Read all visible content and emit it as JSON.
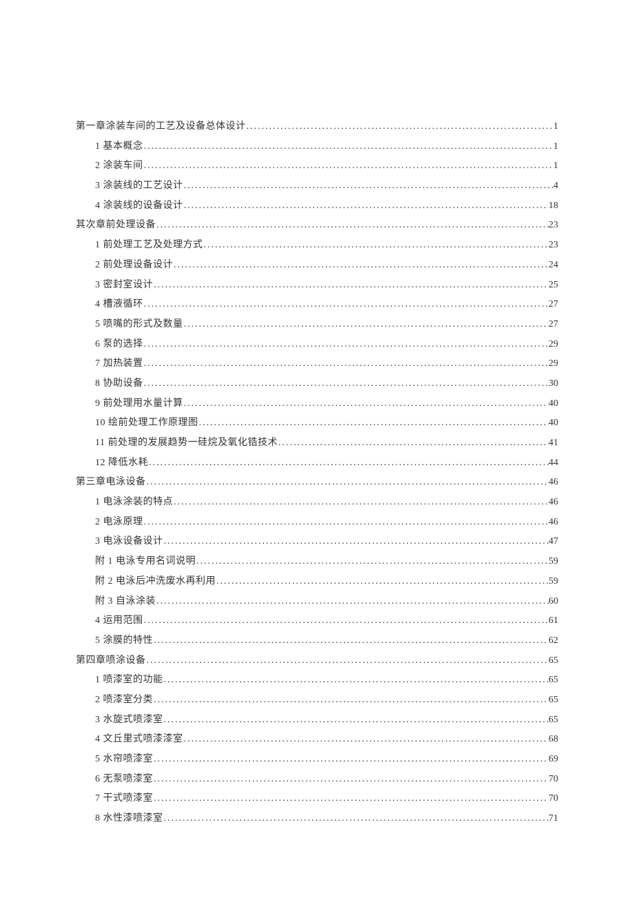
{
  "toc": [
    {
      "level": 1,
      "title": "第一章涂装车间的工艺及设备总体设计",
      "page": "1"
    },
    {
      "level": 2,
      "title": "1 基本概念",
      "page": "1"
    },
    {
      "level": 2,
      "title": "2 涂装车间",
      "page": "1"
    },
    {
      "level": 2,
      "title": "3 涂装线的工艺设计",
      "page": "4"
    },
    {
      "level": 2,
      "title": "4 涂装线的设备设计",
      "page": "18"
    },
    {
      "level": 1,
      "title": "其次章前处理设备",
      "page": "23"
    },
    {
      "level": 2,
      "title": "1 前处理工艺及处理方式",
      "page": "23"
    },
    {
      "level": 2,
      "title": "2 前处理设备设计",
      "page": "24"
    },
    {
      "level": 2,
      "title": "3 密封室设计",
      "page": "25"
    },
    {
      "level": 2,
      "title": "4 槽液循环",
      "page": "27"
    },
    {
      "level": 2,
      "title": "5 喷嘴的形式及数量",
      "page": "27"
    },
    {
      "level": 2,
      "title": "6 泵的选择",
      "page": "29"
    },
    {
      "level": 2,
      "title": "7 加热装置",
      "page": "29"
    },
    {
      "level": 2,
      "title": "8 协助设备",
      "page": "30"
    },
    {
      "level": 2,
      "title": "9 前处理用水量计算",
      "page": "40"
    },
    {
      "level": 2,
      "title": "10 绘前处理工作原理图",
      "page": "40"
    },
    {
      "level": 2,
      "title": "11 前处理的发展趋势一硅烷及氧化锆技术",
      "page": "41"
    },
    {
      "level": 2,
      "title": "12 降低水耗",
      "page": "44"
    },
    {
      "level": 1,
      "title": "第三章电泳设备",
      "page": "46"
    },
    {
      "level": 2,
      "title": "1 电泳涂装的特点",
      "page": "46"
    },
    {
      "level": 2,
      "title": "2 电泳原理",
      "page": "46"
    },
    {
      "level": 2,
      "title": "3 电泳设备设计",
      "page": "47"
    },
    {
      "level": 2,
      "title": "附 1 电泳专用名词说明",
      "page": "59"
    },
    {
      "level": 2,
      "title": "附 2 电泳后冲洗废水再利用",
      "page": "59"
    },
    {
      "level": 2,
      "title": "附 3 自泳涂装",
      "page": "60"
    },
    {
      "level": 2,
      "title": "4 运用范围",
      "page": "61"
    },
    {
      "level": 2,
      "title": "5 涂膜的特性",
      "page": "62"
    },
    {
      "level": 1,
      "title": "第四章喷涂设备",
      "page": "65"
    },
    {
      "level": 2,
      "title": "1 喷漆室的功能",
      "page": "65"
    },
    {
      "level": 2,
      "title": "2 喷漆室分类",
      "page": "65"
    },
    {
      "level": 2,
      "title": "3 水旋式喷漆室",
      "page": "65"
    },
    {
      "level": 2,
      "title": "4 文丘里式喷漆漆室",
      "page": "68"
    },
    {
      "level": 2,
      "title": "5 水帘喷漆室",
      "page": "69"
    },
    {
      "level": 2,
      "title": "6 无泵喷漆室",
      "page": "70"
    },
    {
      "level": 2,
      "title": "7 干式喷漆室",
      "page": "70"
    },
    {
      "level": 2,
      "title": "8 水性漆喷漆室",
      "page": "71"
    }
  ]
}
